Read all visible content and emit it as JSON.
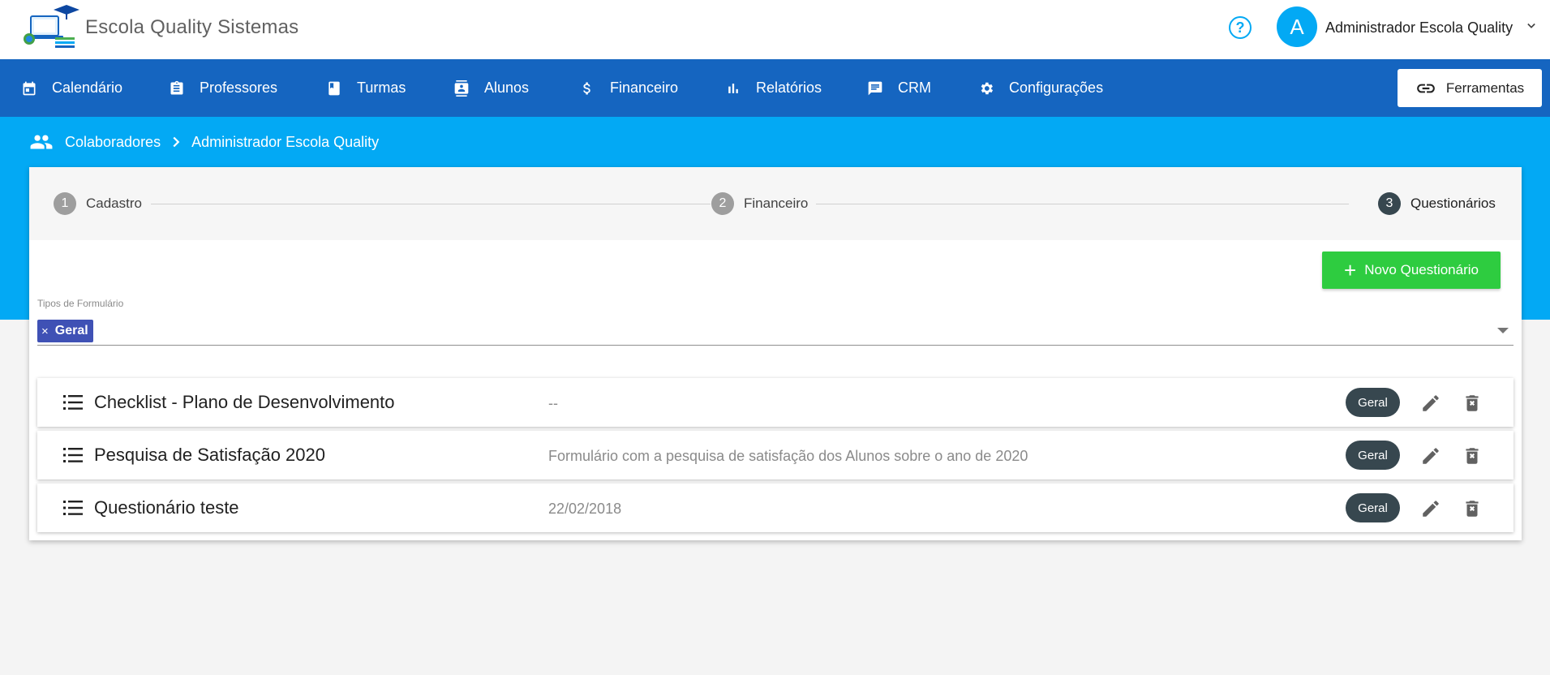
{
  "header": {
    "app_title": "Escola Quality Sistemas",
    "help_glyph": "?",
    "avatar_letter": "A",
    "user_name": "Administrador Escola Quality"
  },
  "nav": {
    "items": [
      {
        "label": "Calendário",
        "icon": "calendar-icon"
      },
      {
        "label": "Professores",
        "icon": "clipboard-icon"
      },
      {
        "label": "Turmas",
        "icon": "book-icon"
      },
      {
        "label": "Alunos",
        "icon": "contact-card-icon"
      },
      {
        "label": "Financeiro",
        "icon": "dollar-icon"
      },
      {
        "label": "Relatórios",
        "icon": "bar-chart-icon"
      },
      {
        "label": "CRM",
        "icon": "chat-icon"
      },
      {
        "label": "Configurações",
        "icon": "gear-icon"
      }
    ],
    "tools_label": "Ferramentas"
  },
  "breadcrumb": {
    "root": "Colaboradores",
    "current": "Administrador Escola Quality"
  },
  "stepper": {
    "steps": [
      {
        "number": "1",
        "label": "Cadastro"
      },
      {
        "number": "2",
        "label": "Financeiro"
      },
      {
        "number": "3",
        "label": "Questionários",
        "active": true
      }
    ]
  },
  "actions": {
    "new_button_label": "Novo Questionário"
  },
  "filter": {
    "label": "Tipos de Formulário",
    "chip_remove": "×",
    "chip_label": "Geral"
  },
  "questionnaires": [
    {
      "title": "Checklist - Plano de Desenvolvimento",
      "description": "--",
      "badge": "Geral"
    },
    {
      "title": "Pesquisa de Satisfação 2020",
      "description": "Formulário com a pesquisa de satisfação dos Alunos sobre o ano de 2020",
      "badge": "Geral"
    },
    {
      "title": "Questionário teste",
      "description": "22/02/2018",
      "badge": "Geral"
    }
  ],
  "colors": {
    "nav_blue": "#1565c0",
    "band_blue": "#03a9f4",
    "success_green": "#2ecc40",
    "chip_indigo": "#3f51b5",
    "badge_dark": "#37474f"
  }
}
